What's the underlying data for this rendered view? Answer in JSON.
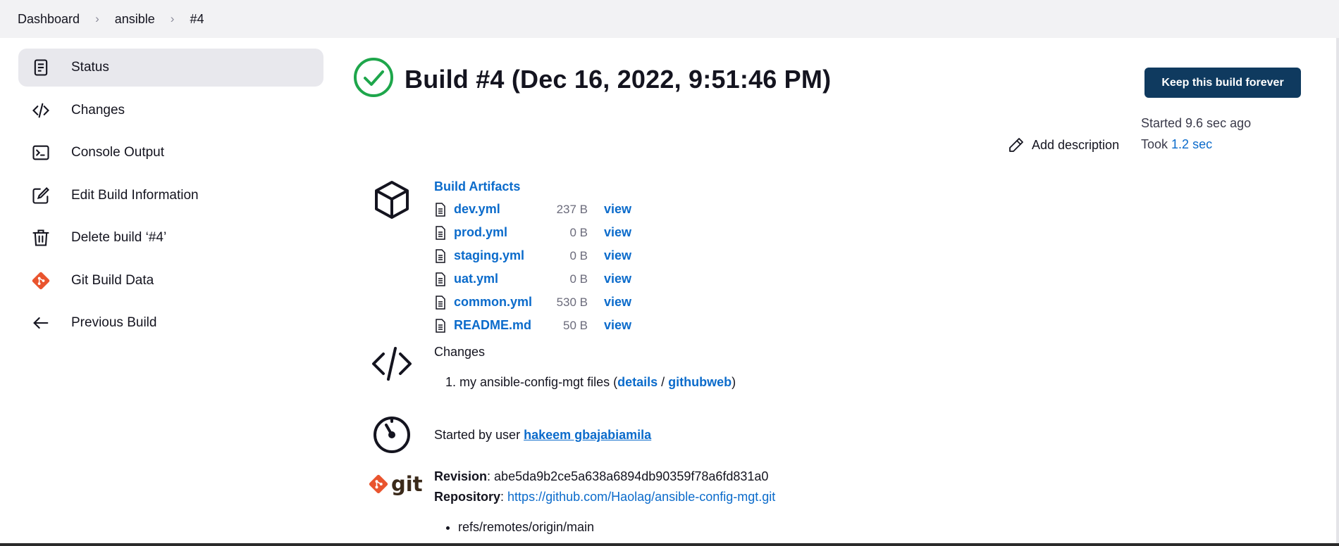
{
  "breadcrumb": [
    "Dashboard",
    "ansible",
    "#4"
  ],
  "sidebar": {
    "items": [
      {
        "label": "Status",
        "icon": "status-document-icon",
        "active": true
      },
      {
        "label": "Changes",
        "icon": "code-icon",
        "active": false
      },
      {
        "label": "Console Output",
        "icon": "terminal-icon",
        "active": false
      },
      {
        "label": "Edit Build Information",
        "icon": "edit-icon",
        "active": false
      },
      {
        "label": "Delete build ‘#4’",
        "icon": "trash-icon",
        "active": false
      },
      {
        "label": "Git Build Data",
        "icon": "git-icon",
        "active": false
      },
      {
        "label": "Previous Build",
        "icon": "arrow-left-icon",
        "active": false
      }
    ]
  },
  "build": {
    "title": "Build #4 (Dec 16, 2022, 9:51:46 PM)",
    "status_color": "#1ea64b",
    "keep_label": "Keep this build forever",
    "started": "Started 9.6 sec ago",
    "took_prefix": "Took",
    "took_value": "1.2 sec",
    "add_description": "Add description"
  },
  "artifacts": {
    "title": "Build Artifacts",
    "files": [
      {
        "name": "dev.yml",
        "size": "237 B",
        "view": "view"
      },
      {
        "name": "prod.yml",
        "size": "0 B",
        "view": "view"
      },
      {
        "name": "staging.yml",
        "size": "0 B",
        "view": "view"
      },
      {
        "name": "uat.yml",
        "size": "0 B",
        "view": "view"
      },
      {
        "name": "common.yml",
        "size": "530 B",
        "view": "view"
      },
      {
        "name": "README.md",
        "size": "50 B",
        "view": "view"
      }
    ]
  },
  "changes": {
    "title": "Changes",
    "items": [
      {
        "text": "my ansible-config-mgt files (",
        "details": "details",
        "sep": " / ",
        "githubweb": "githubweb",
        "close": ")"
      }
    ]
  },
  "started_by": {
    "prefix": "Started by user",
    "user": "hakeem gbajabiamila"
  },
  "git": {
    "logo_text": "git",
    "revision_label": "Revision",
    "revision": "abe5da9b2ce5a638a6894db90359f78a6fd831a0",
    "repository_label": "Repository",
    "repository": "https://github.com/Haolag/ansible-config-mgt.git",
    "branches": [
      "refs/remotes/origin/main"
    ]
  },
  "colors": {
    "accent": "#0b6bcb",
    "button": "#0f3a5f",
    "success": "#1ea64b",
    "git": "#e9542e"
  }
}
